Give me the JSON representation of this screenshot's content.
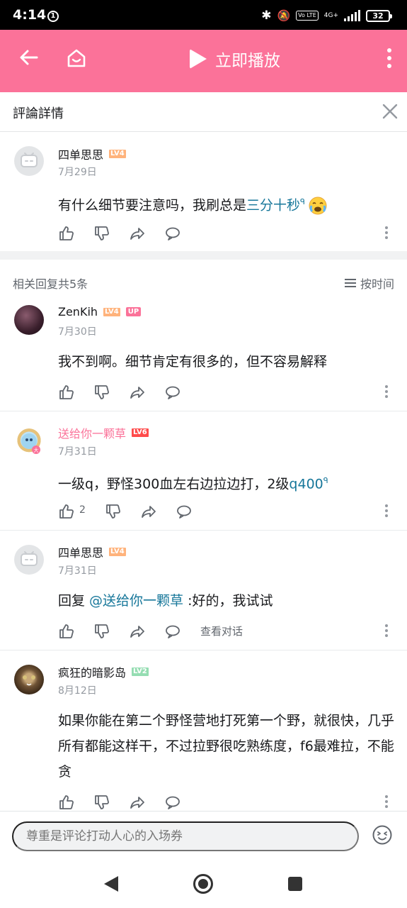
{
  "status_bar": {
    "time": "4:14",
    "notif_count": "1",
    "network": "4G+",
    "volte": "Vo LTE",
    "battery": "32"
  },
  "header": {
    "play_label": "立即播放"
  },
  "title_bar": {
    "title": "評論詳情"
  },
  "main_comment": {
    "username": "四单思思",
    "level": "LV4",
    "date": "7月29日",
    "text_before": "有什么细节要注意吗，我刷总是",
    "link_text": "三分十秒",
    "search_mark": "ᑫ"
  },
  "replies_header": {
    "count_label": "相关回复共5条",
    "sort_label": "按时间"
  },
  "replies": [
    {
      "username": "ZenKih",
      "level": "LV4",
      "up_tag": "UP",
      "date": "7月30日",
      "text": "我不到啊。细节肯定有很多的，但不容易解释"
    },
    {
      "username": "送给你一颗草",
      "level": "LV6",
      "date": "7月31日",
      "text_before": "一级q，野怪300血左右边拉边打，2级",
      "link_text": "q400",
      "search_mark": "ᑫ",
      "like_count": "2"
    },
    {
      "username": "四单思思",
      "level": "LV4",
      "date": "7月31日",
      "reply_prefix": "回复 ",
      "mention": "@送给你一颗草",
      "text_after": " :好的，我试试",
      "view_conversation": "查看对话"
    },
    {
      "username": "疯狂的暗影岛",
      "level": "LV2",
      "date": "8月12日",
      "text": "如果你能在第二个野怪营地打死第一个野，就很快，几乎所有都能这样干，不过拉野很吃熟练度，f6最难拉，不能贪"
    }
  ],
  "bottom_bar": {
    "input_placeholder": "尊重是评论打动人心的入场券"
  },
  "colors": {
    "brand_pink": "#fb7299",
    "link": "#17779a",
    "secondary_text": "#9499a0"
  }
}
